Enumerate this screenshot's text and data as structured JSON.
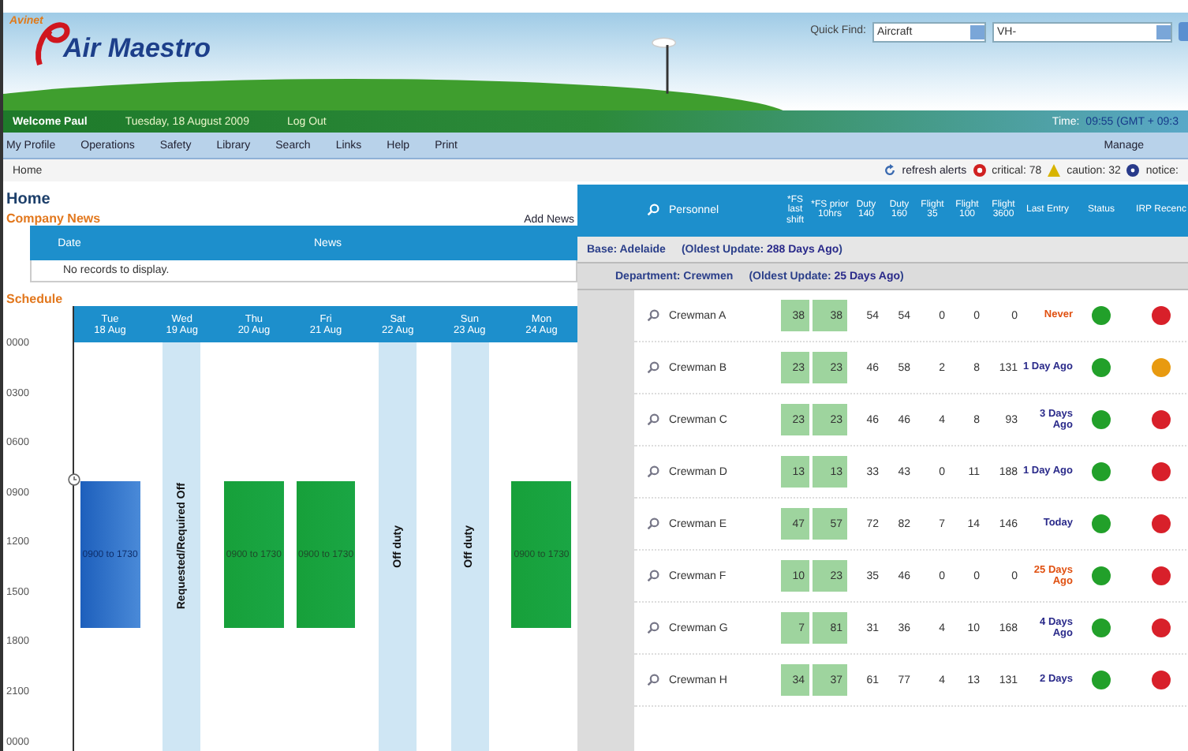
{
  "logo": {
    "tagline": "Avinet",
    "name": "Air Maestro"
  },
  "quick_find": {
    "label": "Quick Find:",
    "category": "Aircraft",
    "value": "VH-"
  },
  "welcome_bar": {
    "greeting": "Welcome Paul",
    "date": "Tuesday, 18 August 2009",
    "logout": "Log Out",
    "time_label": "Time:",
    "time": "09:55 (GMT + 09:3"
  },
  "nav": {
    "items": [
      "My Profile",
      "Operations",
      "Safety",
      "Library",
      "Search",
      "Links",
      "Help",
      "Print"
    ],
    "right": "Manage"
  },
  "breadcrumb": "Home",
  "alerts": {
    "refresh": "refresh alerts",
    "critical": "critical: 78",
    "caution": "caution: 32",
    "notice": "notice:"
  },
  "page_title": "Home",
  "company_news": {
    "title": "Company News",
    "add": "Add News",
    "columns": [
      "Date",
      "News"
    ],
    "empty": "No records to display."
  },
  "schedule": {
    "title": "Schedule",
    "times": [
      "0000",
      "0300",
      "0600",
      "0900",
      "1200",
      "1500",
      "1800",
      "2100",
      "0000"
    ],
    "days": [
      {
        "day": "Tue",
        "date": "18 Aug",
        "kind": "current",
        "text": "0900 to 1730"
      },
      {
        "day": "Wed",
        "date": "19 Aug",
        "kind": "off",
        "text": "Requested/Required Off"
      },
      {
        "day": "Thu",
        "date": "20 Aug",
        "kind": "duty",
        "text": "0900 to 1730"
      },
      {
        "day": "Fri",
        "date": "21 Aug",
        "kind": "duty",
        "text": "0900 to 1730"
      },
      {
        "day": "Sat",
        "date": "22 Aug",
        "kind": "off",
        "text": "Off duty"
      },
      {
        "day": "Sun",
        "date": "23 Aug",
        "kind": "off",
        "text": "Off duty"
      },
      {
        "day": "Mon",
        "date": "24 Aug",
        "kind": "duty",
        "text": "0900 to 1730"
      }
    ]
  },
  "personnel": {
    "columns": [
      "Personnel",
      "*FS last shift",
      "*FS prior 10hrs",
      "Duty 140",
      "Duty 160",
      "Flight 35",
      "Flight 100",
      "Flight 3600",
      "Last Entry",
      "Status",
      "IRP Recenc"
    ],
    "base": {
      "label": "Base: Adelaide",
      "note": "(Oldest Update:",
      "age": "288 Days Ago",
      ")": ")"
    },
    "department": {
      "label": "Department: Crewmen",
      "note": "(Oldest Update:",
      "age": "25 Days Ago",
      ")": ")"
    },
    "rows": [
      {
        "name": "Crewman A",
        "values": [
          "38",
          "38",
          "54",
          "54",
          "0",
          "0",
          "0"
        ],
        "last": "Never",
        "overdue": true,
        "status": {
          "color": "#22a02a"
        },
        "irp": {
          "color": "#d8202a"
        }
      },
      {
        "name": "Crewman B",
        "values": [
          "23",
          "23",
          "46",
          "58",
          "2",
          "8",
          "131"
        ],
        "last": "1 Day Ago",
        "overdue": false,
        "status": {
          "color": "#22a02a"
        },
        "irp": {
          "color": "#e89a10"
        }
      },
      {
        "name": "Crewman C",
        "values": [
          "23",
          "23",
          "46",
          "46",
          "4",
          "8",
          "93"
        ],
        "last": "3 Days Ago",
        "overdue": false,
        "status": {
          "color": "#22a02a"
        },
        "irp": {
          "color": "#d8202a"
        }
      },
      {
        "name": "Crewman D",
        "values": [
          "13",
          "13",
          "33",
          "43",
          "0",
          "11",
          "188"
        ],
        "last": "1 Day Ago",
        "overdue": false,
        "status": {
          "color": "#22a02a"
        },
        "irp": {
          "color": "#d8202a"
        }
      },
      {
        "name": "Crewman E",
        "values": [
          "47",
          "57",
          "72",
          "82",
          "7",
          "14",
          "146"
        ],
        "last": "Today",
        "overdue": false,
        "status": {
          "color": "#22a02a"
        },
        "irp": {
          "color": "#d8202a"
        }
      },
      {
        "name": "Crewman F",
        "values": [
          "10",
          "23",
          "35",
          "46",
          "0",
          "0",
          "0"
        ],
        "last": "25 Days Ago",
        "overdue": true,
        "status": {
          "color": "#22a02a"
        },
        "irp": {
          "color": "#d8202a"
        }
      },
      {
        "name": "Crewman G",
        "values": [
          "7",
          "81",
          "31",
          "36",
          "4",
          "10",
          "168"
        ],
        "last": "4 Days Ago",
        "overdue": false,
        "status": {
          "color": "#22a02a"
        },
        "irp": {
          "color": "#d8202a"
        }
      },
      {
        "name": "Crewman H",
        "values": [
          "34",
          "37",
          "61",
          "77",
          "4",
          "13",
          "131"
        ],
        "last": "2 Days",
        "overdue": false,
        "status": {
          "color": "#22a02a"
        },
        "irp": {
          "color": "#d8202a"
        }
      }
    ]
  }
}
